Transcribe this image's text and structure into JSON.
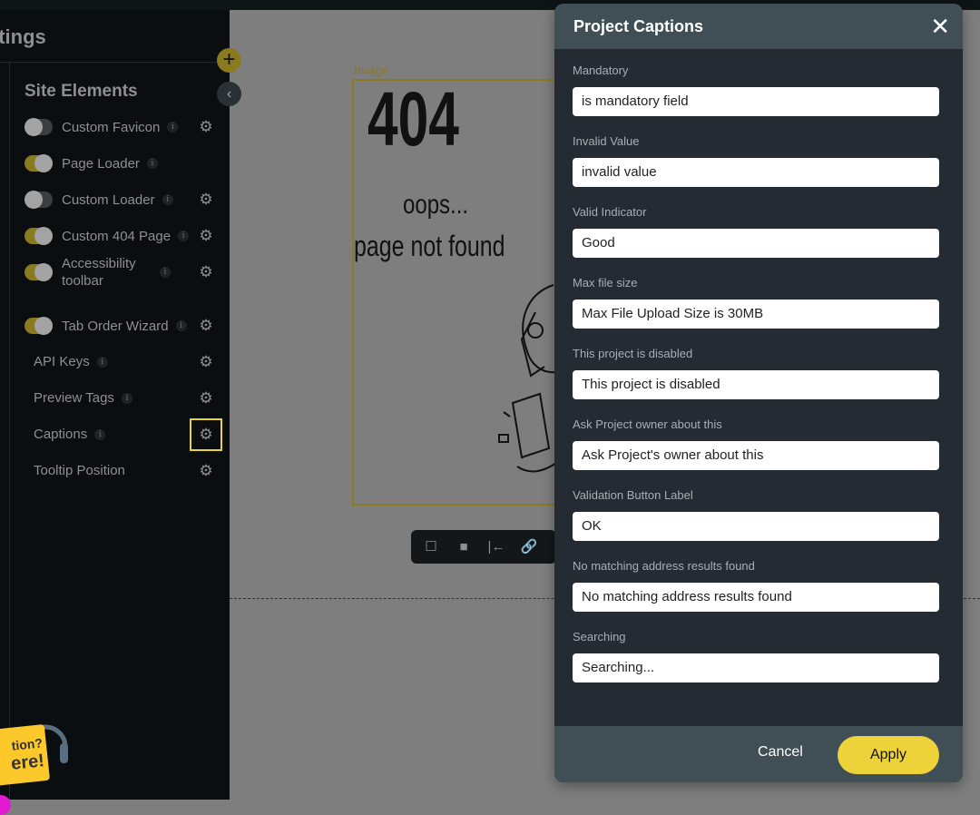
{
  "sidebar": {
    "title": "Settings",
    "section": "Site Elements",
    "items": [
      {
        "label": "Custom Favicon",
        "toggle": false,
        "info": true,
        "gear": true
      },
      {
        "label": "Page Loader",
        "toggle": true,
        "info": true,
        "gear": false
      },
      {
        "label": "Custom Loader",
        "toggle": false,
        "info": true,
        "gear": true
      },
      {
        "label": "Custom 404 Page",
        "toggle": true,
        "info": true,
        "gear": true
      },
      {
        "label": "Accessibility toolbar",
        "toggle": true,
        "info": true,
        "gear": true
      },
      {
        "label": "Tab Order Wizard",
        "toggle": true,
        "info": true,
        "gear": true
      },
      {
        "label": "API Keys",
        "info": true,
        "gear": true
      },
      {
        "label": "Preview Tags",
        "info": true,
        "gear": true
      },
      {
        "label": "Captions",
        "info": true,
        "gear": true,
        "selected": true
      },
      {
        "label": "Tooltip Position",
        "info": false,
        "gear": true
      }
    ]
  },
  "canvas": {
    "image_label": "Image",
    "image_text": {
      "code": "404",
      "line1": "oops...",
      "line2": "page not found"
    }
  },
  "help_widget": {
    "line1": "tion?",
    "line2": "ere!"
  },
  "modal": {
    "title": "Project Captions",
    "fields": [
      {
        "label": "Mandatory",
        "value": "is mandatory field"
      },
      {
        "label": "Invalid Value",
        "value": "invalid value"
      },
      {
        "label": "Valid Indicator",
        "value": "Good"
      },
      {
        "label": "Max file size",
        "value": "Max File Upload Size is 30MB"
      },
      {
        "label": "This project is disabled",
        "value": "This project is disabled"
      },
      {
        "label": "Ask Project owner about this",
        "value": "Ask Project's owner about this"
      },
      {
        "label": "Validation Button Label",
        "value": "OK"
      },
      {
        "label": "No matching address results found",
        "value": "No matching address results found"
      },
      {
        "label": "Searching",
        "value": "Searching..."
      }
    ],
    "cancel": "Cancel",
    "apply": "Apply"
  },
  "colors": {
    "accent": "#edd23a",
    "toggle_on": "#8a7a20",
    "modal_header": "#3f4f55",
    "modal_body": "#242b32"
  }
}
